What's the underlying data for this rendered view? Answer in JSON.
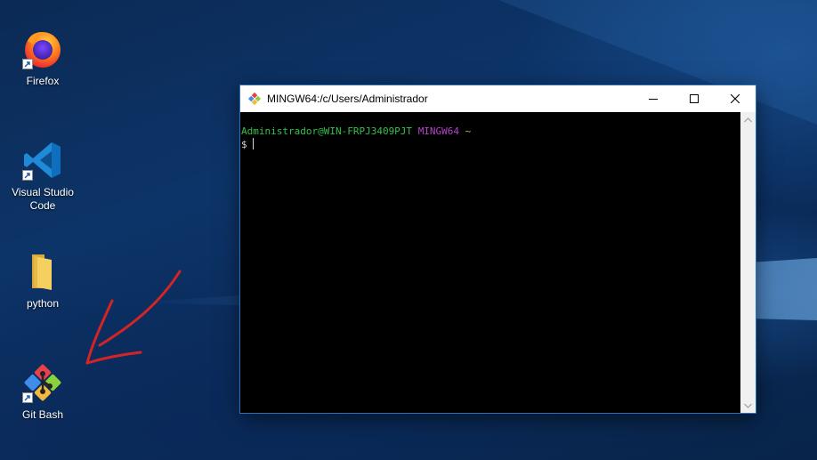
{
  "desktop": {
    "icons": [
      {
        "label": "Firefox",
        "icon": "firefox-icon"
      },
      {
        "label": "Visual Studio Code",
        "icon": "vscode-icon"
      },
      {
        "label": "python",
        "icon": "folder-icon"
      },
      {
        "label": "Git Bash",
        "icon": "git-bash-icon"
      }
    ],
    "annotation": {
      "icon": "red-arrow-annotation",
      "color": "#d42424"
    }
  },
  "window": {
    "title": "MINGW64:/c/Users/Administrador",
    "buttons": {
      "minimize": "minimize-icon",
      "maximize": "maximize-icon",
      "close": "close-icon"
    },
    "console": {
      "user_host": "Administrador@WIN-FRPJ3409PJT",
      "system": "MINGW64",
      "path": "~",
      "prompt": "$"
    },
    "colors": {
      "user_host": "#33c24a",
      "system": "#b444c8",
      "path": "#c8c04a",
      "background": "#000000"
    }
  }
}
